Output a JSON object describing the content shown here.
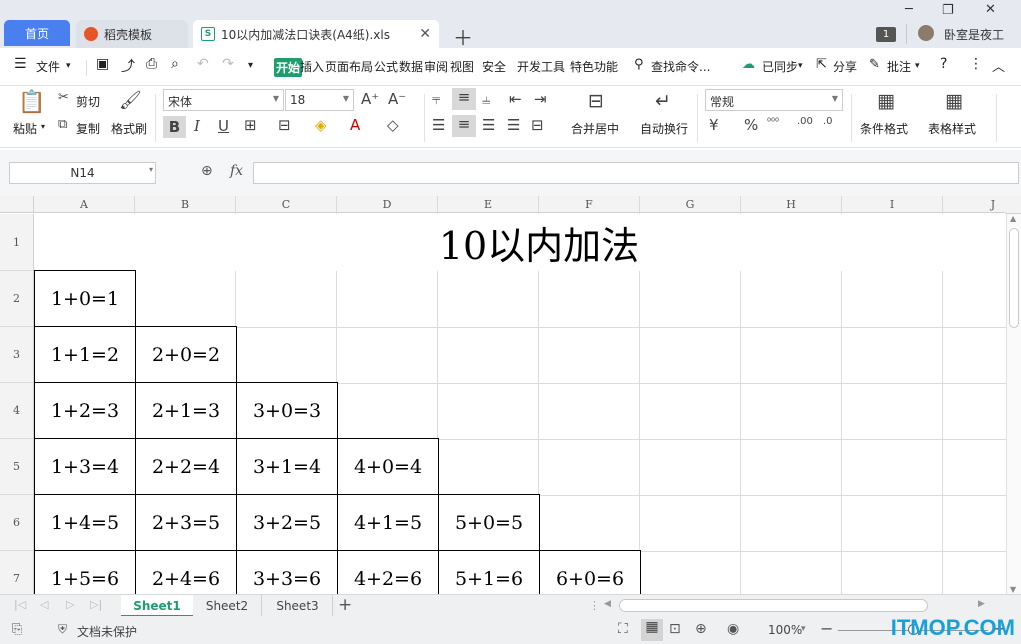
{
  "titlebar": {
    "tabs": [
      {
        "label": "首页"
      },
      {
        "label": "稻壳模板"
      },
      {
        "label": "10以内加减法口诀表(A4纸).xls"
      }
    ],
    "badge": "1",
    "user": "卧室是夜工"
  },
  "menubar": {
    "file": "文件",
    "items": [
      "开始",
      "插入",
      "页面布局",
      "公式",
      "数据",
      "审阅",
      "视图",
      "安全",
      "开发工具",
      "特色功能"
    ],
    "search": "查找命令...",
    "sync": "已同步",
    "share": "分享",
    "comment": "批注"
  },
  "ribbon": {
    "paste": "粘贴",
    "cut": "剪切",
    "copy": "复制",
    "format_painter": "格式刷",
    "font_name": "宋体",
    "font_size": "18",
    "merge_center": "合并居中",
    "wrap_text": "自动换行",
    "number_format": "常规",
    "conditional_format": "条件格式",
    "table_style": "表格样式"
  },
  "formula_bar": {
    "name_box": "N14",
    "fx": "fx",
    "value": ""
  },
  "sheet": {
    "columns": [
      "A",
      "B",
      "C",
      "D",
      "E",
      "F",
      "G",
      "H",
      "I",
      "J"
    ],
    "rows": [
      "1",
      "2",
      "3",
      "4",
      "5",
      "6",
      "7"
    ],
    "title": "10以内加法",
    "equations": [
      [
        "1+0=1"
      ],
      [
        "1+1=2",
        "2+0=2"
      ],
      [
        "1+2=3",
        "2+1=3",
        "3+0=3"
      ],
      [
        "1+3=4",
        "2+2=4",
        "3+1=4",
        "4+0=4"
      ],
      [
        "1+4=5",
        "2+3=5",
        "3+2=5",
        "4+1=5",
        "5+0=5"
      ],
      [
        "1+5=6",
        "2+4=6",
        "3+3=6",
        "4+2=6",
        "5+1=6",
        "6+0=6"
      ]
    ]
  },
  "sheet_tabs": [
    "Sheet1",
    "Sheet2",
    "Sheet3"
  ],
  "statusbar": {
    "protect": "文档未保护",
    "zoom": "100%"
  },
  "watermark": "ITMOP.COM"
}
